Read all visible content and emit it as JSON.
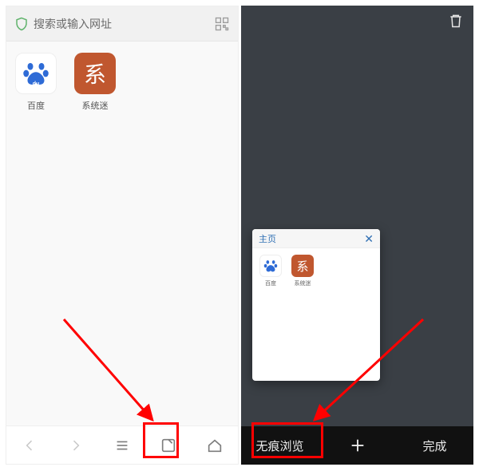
{
  "left": {
    "search_placeholder": "搜索或输入网址",
    "tiles": {
      "baidu_label": "百度",
      "system_label": "系统迷",
      "system_glyph": "系"
    }
  },
  "right": {
    "tab_card": {
      "title": "主页",
      "baidu_label": "百度",
      "system_label": "系统迷",
      "system_glyph": "系"
    },
    "bottombar": {
      "incognito_label": "无痕浏览",
      "done_label": "完成"
    }
  }
}
